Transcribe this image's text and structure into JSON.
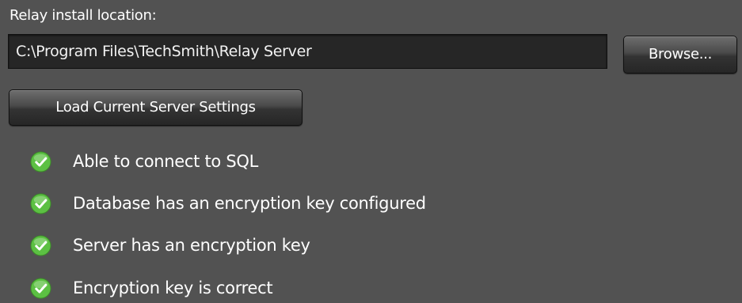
{
  "install": {
    "label": "Relay install location:",
    "path_value": "C:\\Program Files\\TechSmith\\Relay Server"
  },
  "buttons": {
    "browse_label": "Browse...",
    "load_label": "Load Current Server Settings"
  },
  "status_checks": [
    {
      "icon": "check-circle-icon",
      "status": "ok",
      "label": "Able to connect to SQL"
    },
    {
      "icon": "check-circle-icon",
      "status": "ok",
      "label": "Database has an encryption key configured"
    },
    {
      "icon": "check-circle-icon",
      "status": "ok",
      "label": "Server has an encryption key"
    },
    {
      "icon": "check-circle-icon",
      "status": "ok",
      "label": "Encryption key is correct"
    }
  ],
  "colors": {
    "panel_background": "#525252",
    "field_background": "#262626",
    "check_green": "#5cc043",
    "text": "#ffffff"
  }
}
